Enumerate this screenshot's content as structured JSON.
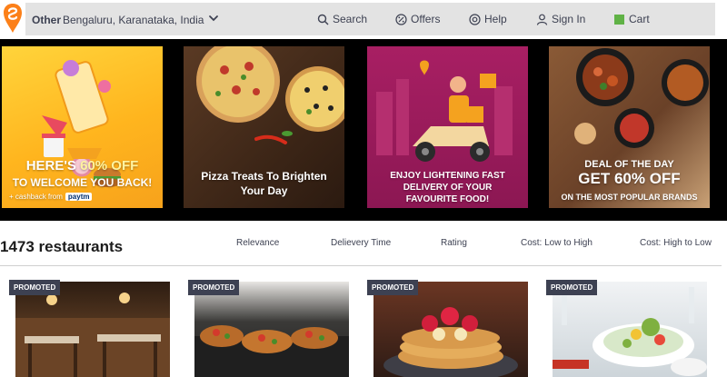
{
  "header": {
    "location_type": "Other",
    "location": "Bengaluru, Karanataka, India",
    "nav": {
      "search": "Search",
      "offers": "Offers",
      "help": "Help",
      "signin": "Sign In",
      "cart": "Cart"
    }
  },
  "offers": {
    "banner1": {
      "line1_a": "HERE'S ",
      "line1_hl": "60% OFF",
      "line2": "TO WELCOME YOU BACK!",
      "line3": "+ cashback from",
      "brand": "paytm"
    },
    "banner2": {
      "text": "Pizza Treats To Brighten Your Day"
    },
    "banner3": {
      "text": "ENJOY LIGHTENING FAST DELIVERY OF YOUR FAVOURITE FOOD!"
    },
    "banner4": {
      "line1": "DEAL OF THE DAY",
      "line2": "GET 60% OFF",
      "line3": "ON THE MOST POPULAR BRANDS"
    }
  },
  "listing": {
    "count": "1473 restaurants",
    "sort": [
      "Relevance",
      "Delievery Time",
      "Rating",
      "Cost: Low to High",
      "Cost: High to Low"
    ]
  },
  "cards": [
    {
      "badge": "PROMOTED"
    },
    {
      "badge": "PROMOTED"
    },
    {
      "badge": "PROMOTED"
    },
    {
      "badge": "PROMOTED"
    }
  ],
  "colors": {
    "brand": "#fc8019",
    "header_bar": "#e3e3e3",
    "text": "#3d4152",
    "cart_icon": "#60b246"
  }
}
